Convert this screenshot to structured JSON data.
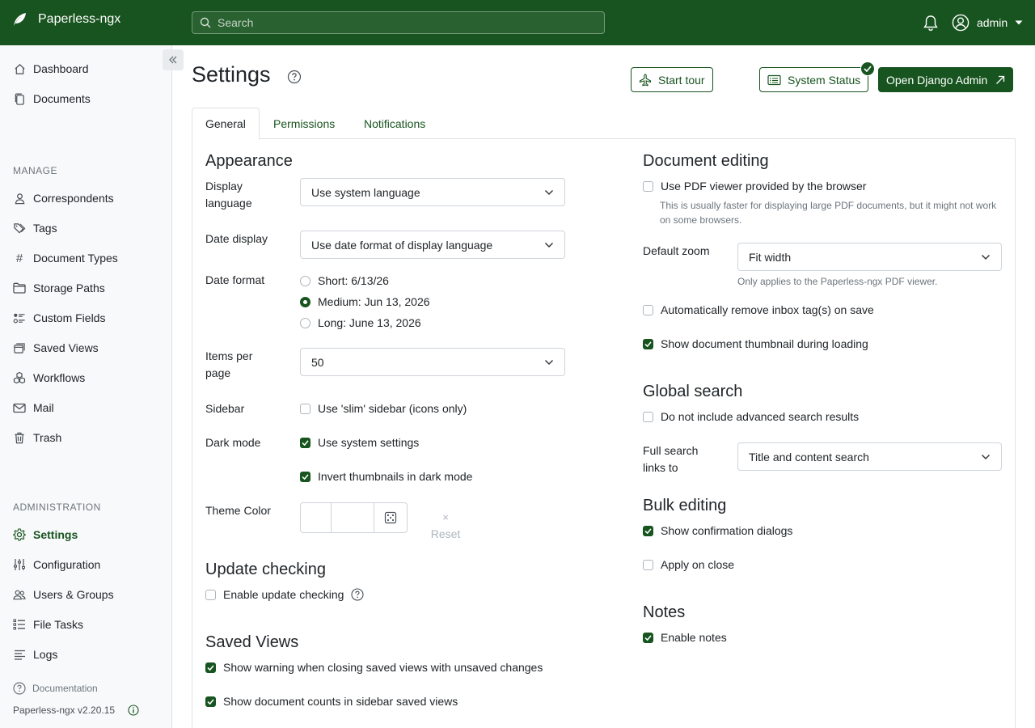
{
  "app": {
    "name": "Paperless-ngx",
    "brand_color": "#17541f"
  },
  "search": {
    "placeholder": "Search"
  },
  "user": {
    "name": "admin"
  },
  "sidebar": {
    "top_items": [
      {
        "label": "Dashboard",
        "icon": "house-icon"
      },
      {
        "label": "Documents",
        "icon": "files-icon"
      }
    ],
    "manage_heading": "MANAGE",
    "manage_items": [
      {
        "label": "Correspondents",
        "icon": "person-icon"
      },
      {
        "label": "Tags",
        "icon": "tags-icon"
      },
      {
        "label": "Document Types",
        "icon": "hash-icon"
      },
      {
        "label": "Storage Paths",
        "icon": "folder-icon"
      },
      {
        "label": "Custom Fields",
        "icon": "ui-radios-icon"
      },
      {
        "label": "Saved Views",
        "icon": "window-stack-icon"
      },
      {
        "label": "Workflows",
        "icon": "boxes-icon"
      },
      {
        "label": "Mail",
        "icon": "envelope-icon"
      },
      {
        "label": "Trash",
        "icon": "trash-icon"
      }
    ],
    "admin_heading": "ADMINISTRATION",
    "admin_items": [
      {
        "label": "Settings",
        "icon": "gear-icon",
        "active": true
      },
      {
        "label": "Configuration",
        "icon": "sliders-icon"
      },
      {
        "label": "Users & Groups",
        "icon": "people-icon"
      },
      {
        "label": "File Tasks",
        "icon": "list-task-icon"
      },
      {
        "label": "Logs",
        "icon": "text-left-icon"
      }
    ],
    "documentation": "Documentation",
    "version": "Paperless-ngx v2.20.15"
  },
  "header": {
    "title": "Settings",
    "start_tour": "Start tour",
    "system_status": "System Status",
    "django_admin": "Open Django Admin"
  },
  "tabs": [
    {
      "label": "General",
      "active": true
    },
    {
      "label": "Permissions"
    },
    {
      "label": "Notifications"
    }
  ],
  "appearance": {
    "heading": "Appearance",
    "display_language_label": "Display language",
    "display_language_value": "Use system language",
    "date_display_label": "Date display",
    "date_display_value": "Use date format of display language",
    "date_format_label": "Date format",
    "date_formats": [
      {
        "label": "Short: 6/13/26",
        "selected": false
      },
      {
        "label": "Medium: Jun 13, 2026",
        "selected": true
      },
      {
        "label": "Long: June 13, 2026",
        "selected": false
      }
    ],
    "items_per_page_label": "Items per page",
    "items_per_page_value": "50",
    "sidebar_label": "Sidebar",
    "slim_sidebar": {
      "label": "Use 'slim' sidebar (icons only)",
      "checked": false
    },
    "dark_mode_label": "Dark mode",
    "use_system_settings": {
      "label": "Use system settings",
      "checked": true
    },
    "invert_thumbnails": {
      "label": "Invert thumbnails in dark mode",
      "checked": true
    },
    "theme_color_label": "Theme Color",
    "reset_label": "Reset"
  },
  "update_checking": {
    "heading": "Update checking",
    "enable": {
      "label": "Enable update checking",
      "checked": false
    }
  },
  "saved_views": {
    "heading": "Saved Views",
    "warn_unsaved": {
      "label": "Show warning when closing saved views with unsaved changes",
      "checked": true
    },
    "show_counts": {
      "label": "Show document counts in sidebar saved views",
      "checked": true
    }
  },
  "document_editing": {
    "heading": "Document editing",
    "pdf_viewer": {
      "label": "Use PDF viewer provided by the browser",
      "checked": false
    },
    "pdf_viewer_hint": "This is usually faster for displaying large PDF documents, but it might not work on some browsers.",
    "default_zoom_label": "Default zoom",
    "default_zoom_value": "Fit width",
    "default_zoom_hint": "Only applies to the Paperless-ngx PDF viewer.",
    "remove_inbox": {
      "label": "Automatically remove inbox tag(s) on save",
      "checked": false
    },
    "show_thumbnail": {
      "label": "Show document thumbnail during loading",
      "checked": true
    }
  },
  "global_search": {
    "heading": "Global search",
    "no_advanced": {
      "label": "Do not include advanced search results",
      "checked": false
    },
    "full_search_label": "Full search links to",
    "full_search_value": "Title and content search"
  },
  "bulk_editing": {
    "heading": "Bulk editing",
    "confirm_dialogs": {
      "label": "Show confirmation dialogs",
      "checked": true
    },
    "apply_on_close": {
      "label": "Apply on close",
      "checked": false
    }
  },
  "notes": {
    "heading": "Notes",
    "enable": {
      "label": "Enable notes",
      "checked": true
    }
  }
}
